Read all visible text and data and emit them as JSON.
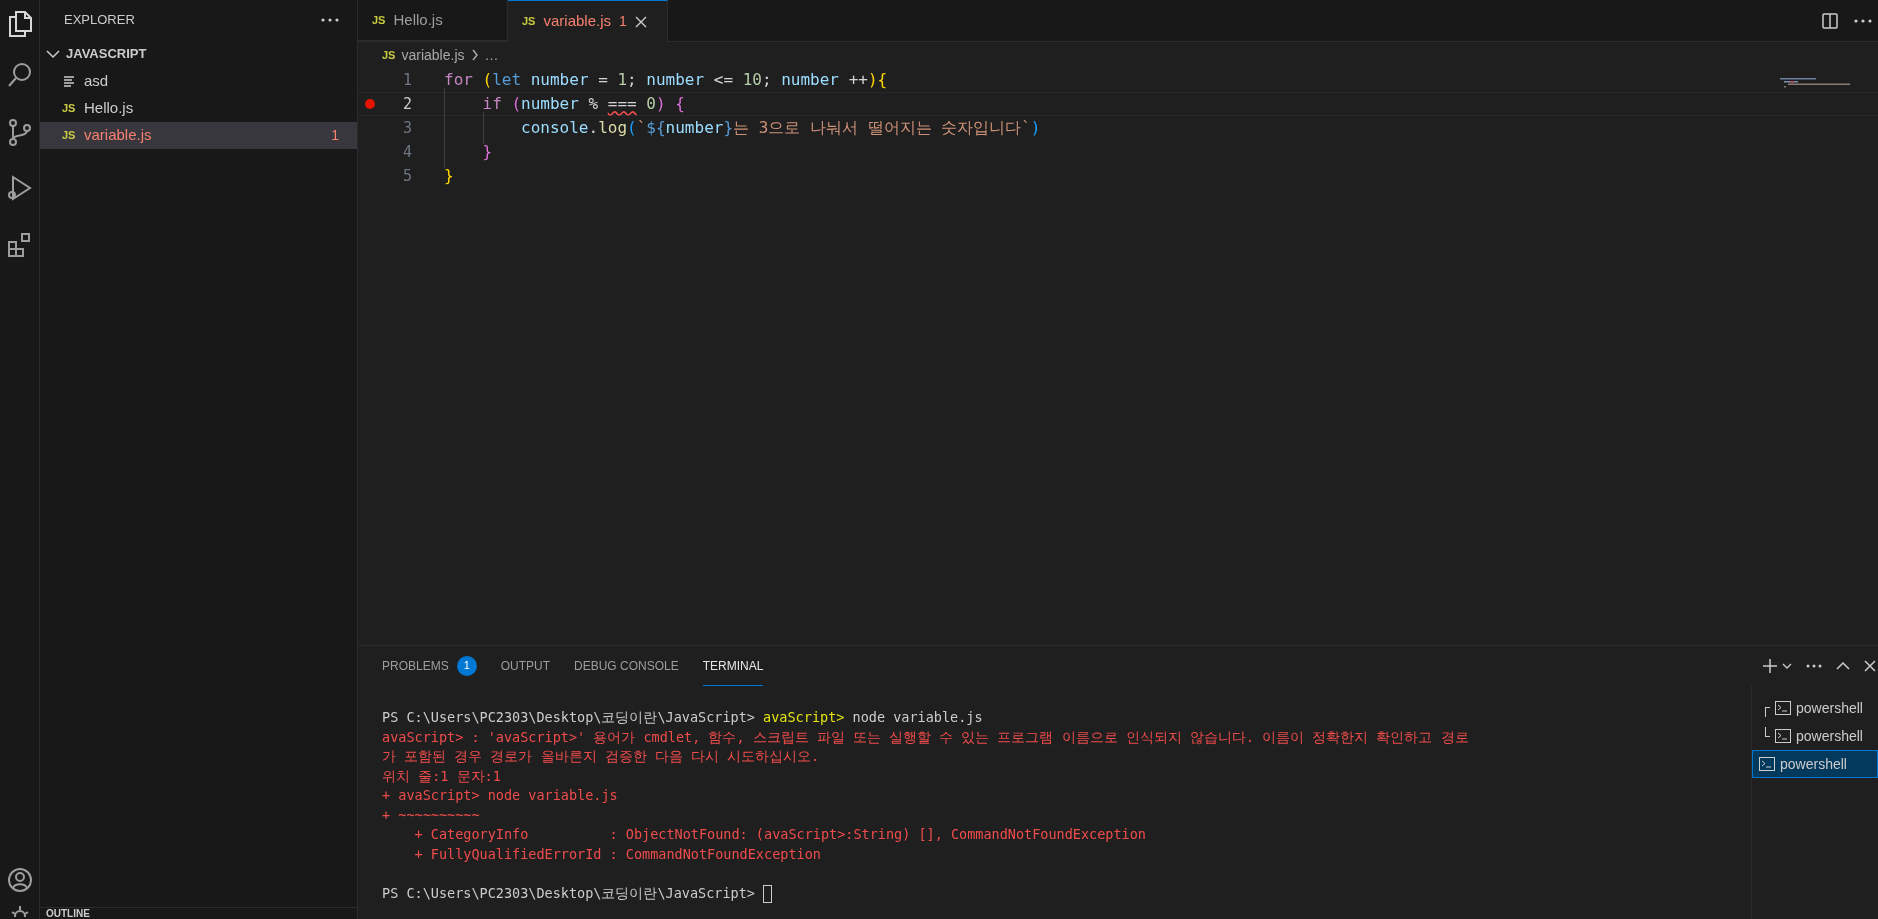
{
  "sidebar": {
    "title": "EXPLORER",
    "folder": {
      "name": "JAVASCRIPT",
      "expanded": true,
      "files": [
        {
          "name": "asd",
          "kind": "text",
          "selected": false,
          "error": false
        },
        {
          "name": "Hello.js",
          "kind": "js",
          "badge": "JS",
          "selected": false,
          "error": false
        },
        {
          "name": "variable.js",
          "kind": "js",
          "badge": "JS",
          "selected": true,
          "error": true,
          "count": "1"
        }
      ]
    },
    "outline": "OUTLINE"
  },
  "tabs": [
    {
      "badge": "JS",
      "label": "Hello.js",
      "selected": false,
      "error": false
    },
    {
      "badge": "JS",
      "label": "variable.js",
      "selected": true,
      "error": true,
      "count": "1"
    }
  ],
  "breadcrumb": {
    "badge": "JS",
    "file": "variable.js",
    "more": "…"
  },
  "code": [
    {
      "number": "1",
      "breakpoint": false,
      "current": false,
      "tokens": [
        {
          "t": "for ",
          "kind": "keyword"
        },
        {
          "t": "(",
          "kind": "bracket1"
        },
        {
          "t": "let",
          "kind": "storage"
        },
        {
          "t": " number ",
          "kind": "variable"
        },
        {
          "t": "= ",
          "kind": "plain"
        },
        {
          "t": "1",
          "kind": "number"
        },
        {
          "t": "; ",
          "kind": "plain"
        },
        {
          "t": "number ",
          "kind": "variable"
        },
        {
          "t": "<= ",
          "kind": "plain"
        },
        {
          "t": "10",
          "kind": "number"
        },
        {
          "t": "; ",
          "kind": "plain"
        },
        {
          "t": "number ",
          "kind": "variable"
        },
        {
          "t": "++",
          "kind": "plain"
        },
        {
          "t": ")",
          "kind": "bracket1"
        },
        {
          "t": "{",
          "kind": "bracket1"
        }
      ]
    },
    {
      "number": "2",
      "breakpoint": true,
      "current": true,
      "tokens": [
        {
          "t": "    if ",
          "kind": "keyword"
        },
        {
          "t": "(",
          "kind": "bracket2"
        },
        {
          "t": "number ",
          "kind": "variable"
        },
        {
          "t": "% ",
          "kind": "plain"
        },
        {
          "t": "===",
          "kind": "error"
        },
        {
          "t": " 0",
          "kind": "number"
        },
        {
          "t": ") ",
          "kind": "bracket2"
        },
        {
          "t": "{",
          "kind": "bracket2"
        }
      ]
    },
    {
      "number": "3",
      "breakpoint": false,
      "current": false,
      "tokens": [
        {
          "t": "        console",
          "kind": "variable"
        },
        {
          "t": ".",
          "kind": "plain"
        },
        {
          "t": "log",
          "kind": "function"
        },
        {
          "t": "(",
          "kind": "bracket3"
        },
        {
          "t": "`",
          "kind": "string"
        },
        {
          "t": "${",
          "kind": "storage"
        },
        {
          "t": "number",
          "kind": "variable"
        },
        {
          "t": "}",
          "kind": "storage"
        },
        {
          "t": "는 3으로 나눠서 떨어지는 숫자입니다`",
          "kind": "string"
        },
        {
          "t": ")",
          "kind": "bracket3"
        }
      ]
    },
    {
      "number": "4",
      "breakpoint": false,
      "current": false,
      "tokens": [
        {
          "t": "    }",
          "kind": "bracket2"
        }
      ]
    },
    {
      "number": "5",
      "breakpoint": false,
      "current": false,
      "tokens": [
        {
          "t": "}",
          "kind": "bracket1"
        }
      ]
    }
  ],
  "panel": {
    "tabs": [
      {
        "label": "PROBLEMS",
        "selected": false,
        "count": "1"
      },
      {
        "label": "OUTPUT",
        "selected": false
      },
      {
        "label": "DEBUG CONSOLE",
        "selected": false
      },
      {
        "label": "TERMINAL",
        "selected": true
      }
    ],
    "terminal": [
      {
        "cursor": false,
        "blank_before": false,
        "tokens": [
          {
            "t": "PS C:\\Users\\PC2303\\Desktop\\코딩이란\\JavaScript> ",
            "kind": "plain"
          },
          {
            "t": "avaScript>",
            "kind": "highlight"
          },
          {
            "t": " node variable.js",
            "kind": "plain"
          }
        ]
      },
      {
        "cursor": false,
        "blank_before": false,
        "tokens": [
          {
            "t": "avaScript> : 'avaScript>' 용어가 cmdlet, 함수, 스크립트 파일 또는 실행할 수 있는 프로그램 이름으로 인식되지 않습니다. 이름이 정확한지 확인하고 경로",
            "kind": "error"
          }
        ]
      },
      {
        "cursor": false,
        "blank_before": false,
        "tokens": [
          {
            "t": "가 포함된 경우 경로가 올바른지 검증한 다음 다시 시도하십시오.",
            "kind": "error"
          }
        ]
      },
      {
        "cursor": false,
        "blank_before": false,
        "tokens": [
          {
            "t": "위치 줄:1 문자:1",
            "kind": "error"
          }
        ]
      },
      {
        "cursor": false,
        "blank_before": false,
        "tokens": [
          {
            "t": "+ avaScript> node variable.js",
            "kind": "error"
          }
        ]
      },
      {
        "cursor": false,
        "blank_before": false,
        "tokens": [
          {
            "t": "+ ~~~~~~~~~~",
            "kind": "error"
          }
        ]
      },
      {
        "cursor": false,
        "blank_before": false,
        "tokens": [
          {
            "t": "    + CategoryInfo          : ObjectNotFound: (avaScript>:String) [], CommandNotFoundException",
            "kind": "error"
          }
        ]
      },
      {
        "cursor": false,
        "blank_before": false,
        "tokens": [
          {
            "t": "    + FullyQualifiedErrorId : CommandNotFoundException",
            "kind": "error"
          }
        ]
      },
      {
        "cursor": true,
        "blank_before": true,
        "tokens": [
          {
            "t": "PS C:\\Users\\PC2303\\Desktop\\코딩이란\\JavaScript> ",
            "kind": "plain"
          }
        ]
      }
    ],
    "shells": [
      {
        "label": "powershell",
        "selected": false
      },
      {
        "label": "powershell",
        "selected": false
      },
      {
        "label": "powershell",
        "selected": true
      }
    ]
  }
}
